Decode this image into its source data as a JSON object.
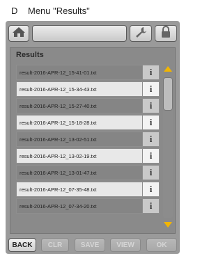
{
  "caption": {
    "letter": "D",
    "text": "Menu \"Results\""
  },
  "topbar": {
    "home_icon": "home-icon",
    "wrench_icon": "wrench-icon",
    "lock_icon": "lock-icon"
  },
  "panel": {
    "title": "Results",
    "info_label": "i",
    "files": [
      "result-2016-APR-12_15-41-01.txt",
      "result-2016-APR-12_15-34-43.txt",
      "result-2016-APR-12_15-27-40.txt",
      "result-2016-APR-12_15-18-28.txt",
      "result-2016-APR-12_13-02-51.txt",
      "result-2016-APR-12_13-02-19.txt",
      "result-2016-APR-12_13-01-47.txt",
      "result-2016-APR-12_07-35-48.txt",
      "result-2016-APR-12_07-34-20.txt"
    ]
  },
  "scroll": {
    "up_color": "#f2b500",
    "down_color": "#f2b500"
  },
  "buttons": {
    "back": "BACK",
    "clr": "CLR",
    "save": "SAVE",
    "view": "VIEW",
    "ok": "OK"
  }
}
